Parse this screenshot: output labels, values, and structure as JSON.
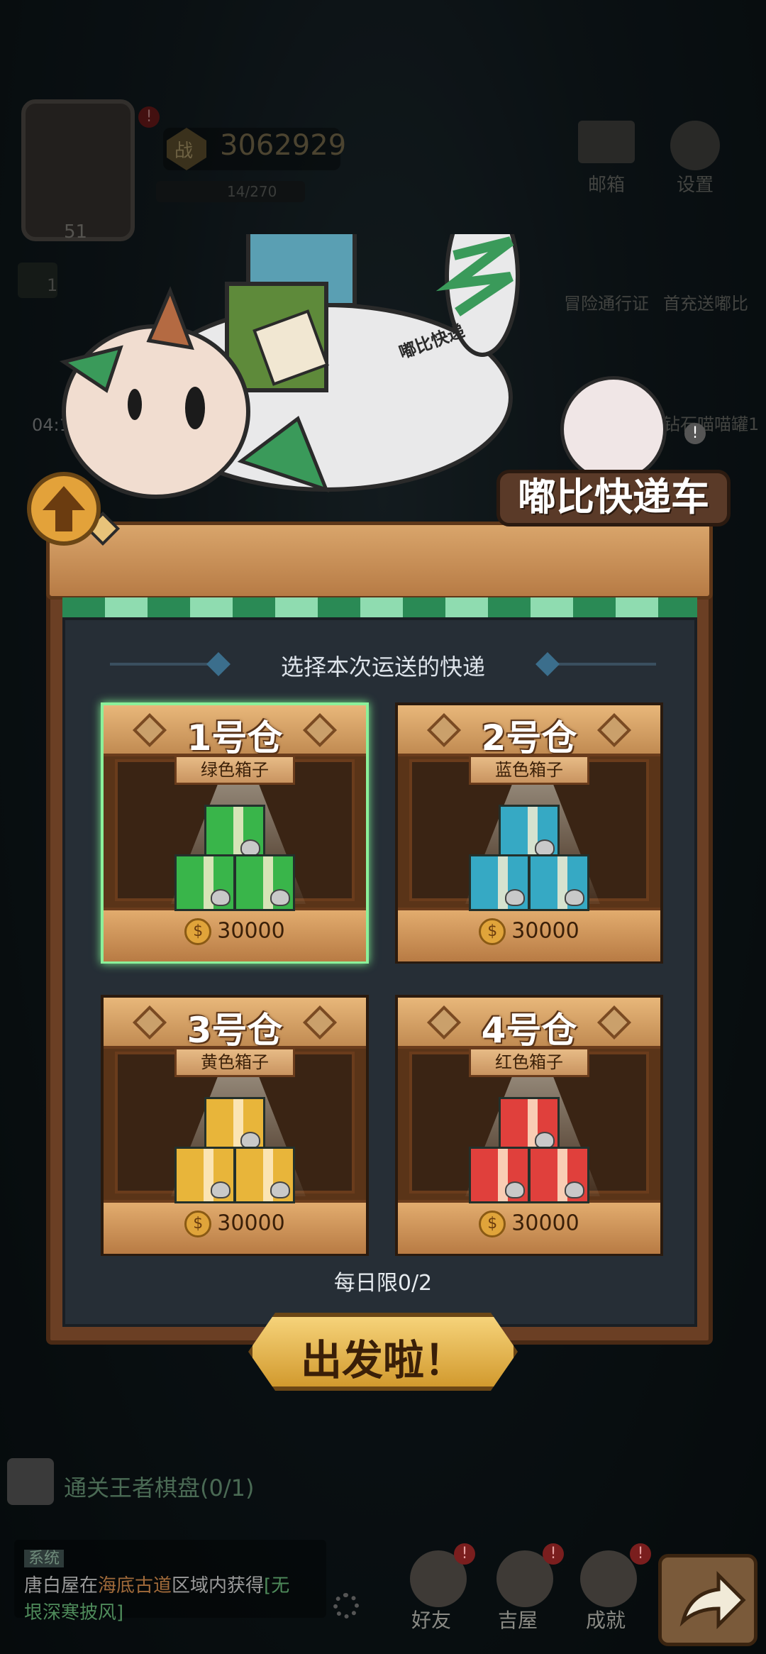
{
  "hud": {
    "power": "3062929",
    "energy": "14/270",
    "level": "51",
    "timer": "04:11:41",
    "mail_label": "邮箱",
    "settings_label": "设置",
    "battle_pass_label": "冒险通行证",
    "first_recharge_label": "首充送嘟比",
    "side_label_cut": "钻石喵喵罐1",
    "power_icon_text": "战",
    "side_count": "1"
  },
  "panel": {
    "title": "嘟比快递车",
    "prompt": "选择本次运送的快递",
    "daily_limit": "每日限0/2",
    "go_button": "出发啦！",
    "bag_tag": "嘟比快递"
  },
  "warehouses": [
    {
      "name": "1号仓",
      "box": "绿色箱子",
      "price": "30000",
      "color": "#39b54a",
      "selected": true
    },
    {
      "name": "2号仓",
      "box": "蓝色箱子",
      "price": "30000",
      "color": "#36a9c4",
      "selected": false
    },
    {
      "name": "3号仓",
      "box": "黄色箱子",
      "price": "30000",
      "color": "#e8b53a",
      "selected": false
    },
    {
      "name": "4号仓",
      "box": "红色箱子",
      "price": "30000",
      "color": "#e0403c",
      "selected": false
    }
  ],
  "bottom": {
    "quest": "通关王者棋盘(0/1)",
    "chat_tag": "系统",
    "chat_line1_a": "唐白屋在",
    "chat_line1_b": "海底古道",
    "chat_line1_c": "区域内获得",
    "chat_line1_d": "[无",
    "chat_line2": "垠深寒披风]",
    "nav": [
      "好友",
      "吉屋",
      "成就"
    ],
    "bang": "!"
  }
}
